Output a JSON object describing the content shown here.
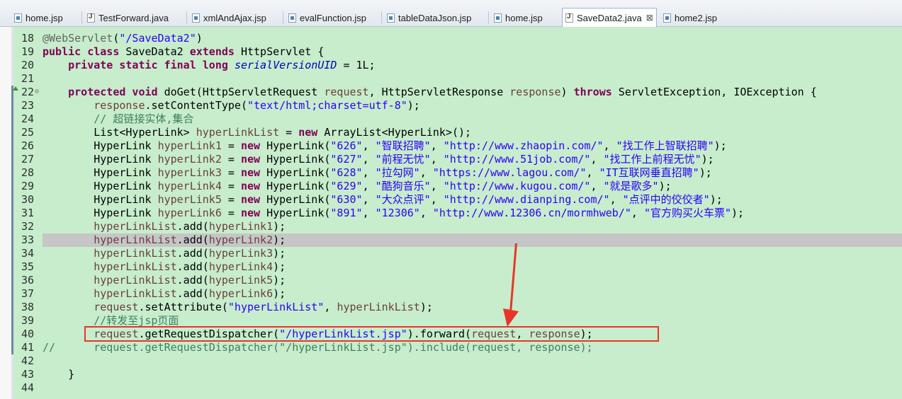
{
  "tabs": [
    {
      "label": "home.jsp",
      "icon": "jsp-file-icon"
    },
    {
      "label": "TestForward.java",
      "icon": "java-file-icon"
    },
    {
      "label": "xmlAndAjax.jsp",
      "icon": "jsp-file-icon"
    },
    {
      "label": "evalFunction.jsp",
      "icon": "jsp-file-icon"
    },
    {
      "label": "tableDataJson.jsp",
      "icon": "jsp-file-icon"
    },
    {
      "label": "home.jsp",
      "icon": "jsp-file-icon"
    },
    {
      "label": "SaveData2.java",
      "icon": "java-file-icon",
      "active": true,
      "close": "⊠"
    },
    {
      "label": "home2.jsp",
      "icon": "jsp-file-icon"
    }
  ],
  "lines": [
    {
      "n": "18",
      "parts": [
        [
          "ann",
          "@WebServlet"
        ],
        [
          "",
          "("
        ],
        [
          "st",
          "\"/SaveData2\""
        ],
        [
          "",
          ")"
        ]
      ]
    },
    {
      "n": "19",
      "parts": [
        [
          "kw",
          "public class"
        ],
        [
          "",
          " SaveData2 "
        ],
        [
          "kw",
          "extends"
        ],
        [
          "",
          " HttpServlet {"
        ]
      ]
    },
    {
      "n": "20",
      "parts": [
        [
          "",
          "    "
        ],
        [
          "kw",
          "private static final long"
        ],
        [
          "",
          " "
        ],
        [
          "fld",
          "serialVersionUID"
        ],
        [
          "",
          " = 1L;"
        ]
      ]
    },
    {
      "n": "21",
      "parts": []
    },
    {
      "n": "22",
      "parts": [
        [
          "",
          "    "
        ],
        [
          "kw",
          "protected void"
        ],
        [
          "",
          " doGet(HttpServletRequest "
        ],
        [
          "par",
          "request"
        ],
        [
          "",
          ", HttpServletResponse "
        ],
        [
          "par",
          "response"
        ],
        [
          "",
          ") "
        ],
        [
          "kw",
          "throws"
        ],
        [
          "",
          " ServletException, IOException {"
        ]
      ]
    },
    {
      "n": "23",
      "parts": [
        [
          "",
          "        "
        ],
        [
          "par",
          "response"
        ],
        [
          "",
          ".setContentType("
        ],
        [
          "st",
          "\"text/html;charset=utf-8\""
        ],
        [
          "",
          ");"
        ]
      ]
    },
    {
      "n": "24",
      "parts": [
        [
          "",
          "        "
        ],
        [
          "cm",
          "// 超链接实体,集合"
        ]
      ]
    },
    {
      "n": "25",
      "parts": [
        [
          "",
          "        List<HyperLink> "
        ],
        [
          "par",
          "hyperLinkList"
        ],
        [
          "",
          " = "
        ],
        [
          "kw",
          "new"
        ],
        [
          "",
          " ArrayList<HyperLink>();"
        ]
      ]
    },
    {
      "n": "26",
      "parts": [
        [
          "",
          "        HyperLink "
        ],
        [
          "par",
          "hyperLink1"
        ],
        [
          "",
          " = "
        ],
        [
          "kw",
          "new"
        ],
        [
          "",
          " HyperLink("
        ],
        [
          "st",
          "\"626\""
        ],
        [
          "",
          ", "
        ],
        [
          "st",
          "\"智联招聘\""
        ],
        [
          "",
          ", "
        ],
        [
          "st",
          "\"http://www.zhaopin.com/\""
        ],
        [
          "",
          ", "
        ],
        [
          "st",
          "\"找工作上智联招聘\""
        ],
        [
          "",
          ");"
        ]
      ]
    },
    {
      "n": "27",
      "parts": [
        [
          "",
          "        HyperLink "
        ],
        [
          "par",
          "hyperLink2"
        ],
        [
          "",
          " = "
        ],
        [
          "kw",
          "new"
        ],
        [
          "",
          " HyperLink("
        ],
        [
          "st",
          "\"627\""
        ],
        [
          "",
          ", "
        ],
        [
          "st",
          "\"前程无忧\""
        ],
        [
          "",
          ", "
        ],
        [
          "st",
          "\"http://www.51job.com/\""
        ],
        [
          "",
          ", "
        ],
        [
          "st",
          "\"找工作上前程无忧\""
        ],
        [
          "",
          ");"
        ]
      ]
    },
    {
      "n": "28",
      "parts": [
        [
          "",
          "        HyperLink "
        ],
        [
          "par",
          "hyperLink3"
        ],
        [
          "",
          " = "
        ],
        [
          "kw",
          "new"
        ],
        [
          "",
          " HyperLink("
        ],
        [
          "st",
          "\"628\""
        ],
        [
          "",
          ", "
        ],
        [
          "st",
          "\"拉勾网\""
        ],
        [
          "",
          ", "
        ],
        [
          "st",
          "\"https://www.lagou.com/\""
        ],
        [
          "",
          ", "
        ],
        [
          "st",
          "\"IT互联网垂直招聘\""
        ],
        [
          "",
          ");"
        ]
      ]
    },
    {
      "n": "29",
      "parts": [
        [
          "",
          "        HyperLink "
        ],
        [
          "par",
          "hyperLink4"
        ],
        [
          "",
          " = "
        ],
        [
          "kw",
          "new"
        ],
        [
          "",
          " HyperLink("
        ],
        [
          "st",
          "\"629\""
        ],
        [
          "",
          ", "
        ],
        [
          "st",
          "\"酷狗音乐\""
        ],
        [
          "",
          ", "
        ],
        [
          "st",
          "\"http://www.kugou.com/\""
        ],
        [
          "",
          ", "
        ],
        [
          "st",
          "\"就是歌多\""
        ],
        [
          "",
          ");"
        ]
      ]
    },
    {
      "n": "30",
      "parts": [
        [
          "",
          "        HyperLink "
        ],
        [
          "par",
          "hyperLink5"
        ],
        [
          "",
          " = "
        ],
        [
          "kw",
          "new"
        ],
        [
          "",
          " HyperLink("
        ],
        [
          "st",
          "\"630\""
        ],
        [
          "",
          ", "
        ],
        [
          "st",
          "\"大众点评\""
        ],
        [
          "",
          ", "
        ],
        [
          "st",
          "\"http://www.dianping.com/\""
        ],
        [
          "",
          ", "
        ],
        [
          "st",
          "\"点评中的佼佼者\""
        ],
        [
          "",
          ");"
        ]
      ]
    },
    {
      "n": "31",
      "parts": [
        [
          "",
          "        HyperLink "
        ],
        [
          "par",
          "hyperLink6"
        ],
        [
          "",
          " = "
        ],
        [
          "kw",
          "new"
        ],
        [
          "",
          " HyperLink("
        ],
        [
          "st",
          "\"891\""
        ],
        [
          "",
          ", "
        ],
        [
          "st",
          "\"12306\""
        ],
        [
          "",
          ", "
        ],
        [
          "st",
          "\"http://www.12306.cn/mormhweb/\""
        ],
        [
          "",
          ", "
        ],
        [
          "st",
          "\"官方购买火车票\""
        ],
        [
          "",
          ");"
        ]
      ]
    },
    {
      "n": "32",
      "parts": [
        [
          "",
          "        "
        ],
        [
          "par",
          "hyperLinkList"
        ],
        [
          "",
          ".add("
        ],
        [
          "par",
          "hyperLink1"
        ],
        [
          "",
          ");"
        ]
      ]
    },
    {
      "n": "33",
      "parts": [
        [
          "",
          "        "
        ],
        [
          "par",
          "hyperLinkList"
        ],
        [
          "",
          ".add("
        ],
        [
          "par",
          "hyperLink2"
        ],
        [
          "",
          ");"
        ]
      ],
      "highlight": true
    },
    {
      "n": "34",
      "parts": [
        [
          "",
          "        "
        ],
        [
          "par",
          "hyperLinkList"
        ],
        [
          "",
          ".add("
        ],
        [
          "par",
          "hyperLink3"
        ],
        [
          "",
          ");"
        ]
      ]
    },
    {
      "n": "35",
      "parts": [
        [
          "",
          "        "
        ],
        [
          "par",
          "hyperLinkList"
        ],
        [
          "",
          ".add("
        ],
        [
          "par",
          "hyperLink4"
        ],
        [
          "",
          ");"
        ]
      ]
    },
    {
      "n": "36",
      "parts": [
        [
          "",
          "        "
        ],
        [
          "par",
          "hyperLinkList"
        ],
        [
          "",
          ".add("
        ],
        [
          "par",
          "hyperLink5"
        ],
        [
          "",
          ");"
        ]
      ]
    },
    {
      "n": "37",
      "parts": [
        [
          "",
          "        "
        ],
        [
          "par",
          "hyperLinkList"
        ],
        [
          "",
          ".add("
        ],
        [
          "par",
          "hyperLink6"
        ],
        [
          "",
          ");"
        ]
      ]
    },
    {
      "n": "38",
      "parts": [
        [
          "",
          "        "
        ],
        [
          "par",
          "request"
        ],
        [
          "",
          ".setAttribute("
        ],
        [
          "st",
          "\"hyperLinkList\""
        ],
        [
          "",
          ", "
        ],
        [
          "par",
          "hyperLinkList"
        ],
        [
          "",
          ");"
        ]
      ]
    },
    {
      "n": "39",
      "parts": [
        [
          "",
          "        "
        ],
        [
          "cm",
          "//转发至jsp页面"
        ]
      ]
    },
    {
      "n": "40",
      "parts": [
        [
          "",
          "        "
        ],
        [
          "par",
          "request"
        ],
        [
          "",
          ".getRequestDispatcher("
        ],
        [
          "st",
          "\"/hyperLinkList.jsp\""
        ],
        [
          "",
          ").forward("
        ],
        [
          "par",
          "request"
        ],
        [
          "",
          ", "
        ],
        [
          "par",
          "response"
        ],
        [
          "",
          ");"
        ]
      ]
    },
    {
      "n": "41",
      "parts": [
        [
          "cm",
          "//      request.getRequestDispatcher(\"/hyperLinkList.jsp\").include(request, response);"
        ]
      ]
    },
    {
      "n": "42",
      "parts": []
    },
    {
      "n": "43",
      "parts": [
        [
          "",
          "    }"
        ]
      ]
    },
    {
      "n": "44",
      "parts": []
    }
  ]
}
